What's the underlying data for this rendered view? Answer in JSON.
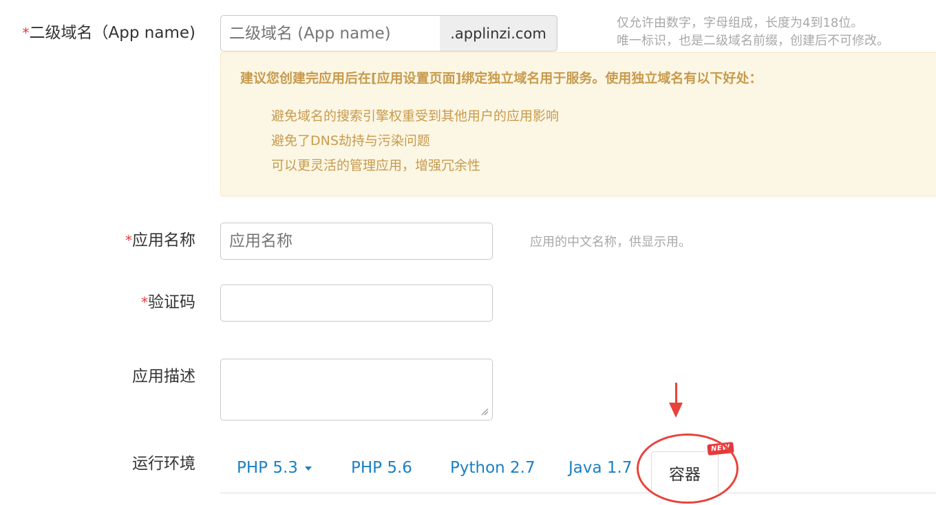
{
  "form": {
    "app_name_label": "二级域名（App name)",
    "app_name_placeholder": "二级域名 (App name)",
    "domain_suffix": ".applinzi.com",
    "app_name_help_line1": "仅允许由数字，字母组成，长度为4到18位。",
    "app_name_help_line2": "唯一标识，也是二级域名前缀，创建后不可修改。",
    "required_mark": "*",
    "alert": {
      "title": "建议您创建完应用后在[应用设置页面]绑定独立域名用于服务。使用独立域名有以下好处：",
      "items": [
        "避免域名的搜索引擎权重受到其他用户的应用影响",
        "避免了DNS劫持与污染问题",
        "可以更灵活的管理应用，增强冗余性"
      ]
    },
    "display_name_label": "应用名称",
    "display_name_placeholder": "应用名称",
    "display_name_help": "应用的中文名称，供显示用。",
    "captcha_label": "验证码",
    "description_label": "应用描述",
    "runtime_label": "运行环境"
  },
  "runtime_tabs": {
    "php53": "PHP 5.3",
    "php56": "PHP 5.6",
    "python27": "Python 2.7",
    "java17": "Java 1.7",
    "container": "容器",
    "new_badge": "NEW",
    "active": "容器"
  },
  "colors": {
    "required": "#e4393c",
    "link": "#1a80c4",
    "alert_text": "#c79a4e",
    "alert_bg": "#fcf7e4",
    "annotation": "#e8423a"
  }
}
